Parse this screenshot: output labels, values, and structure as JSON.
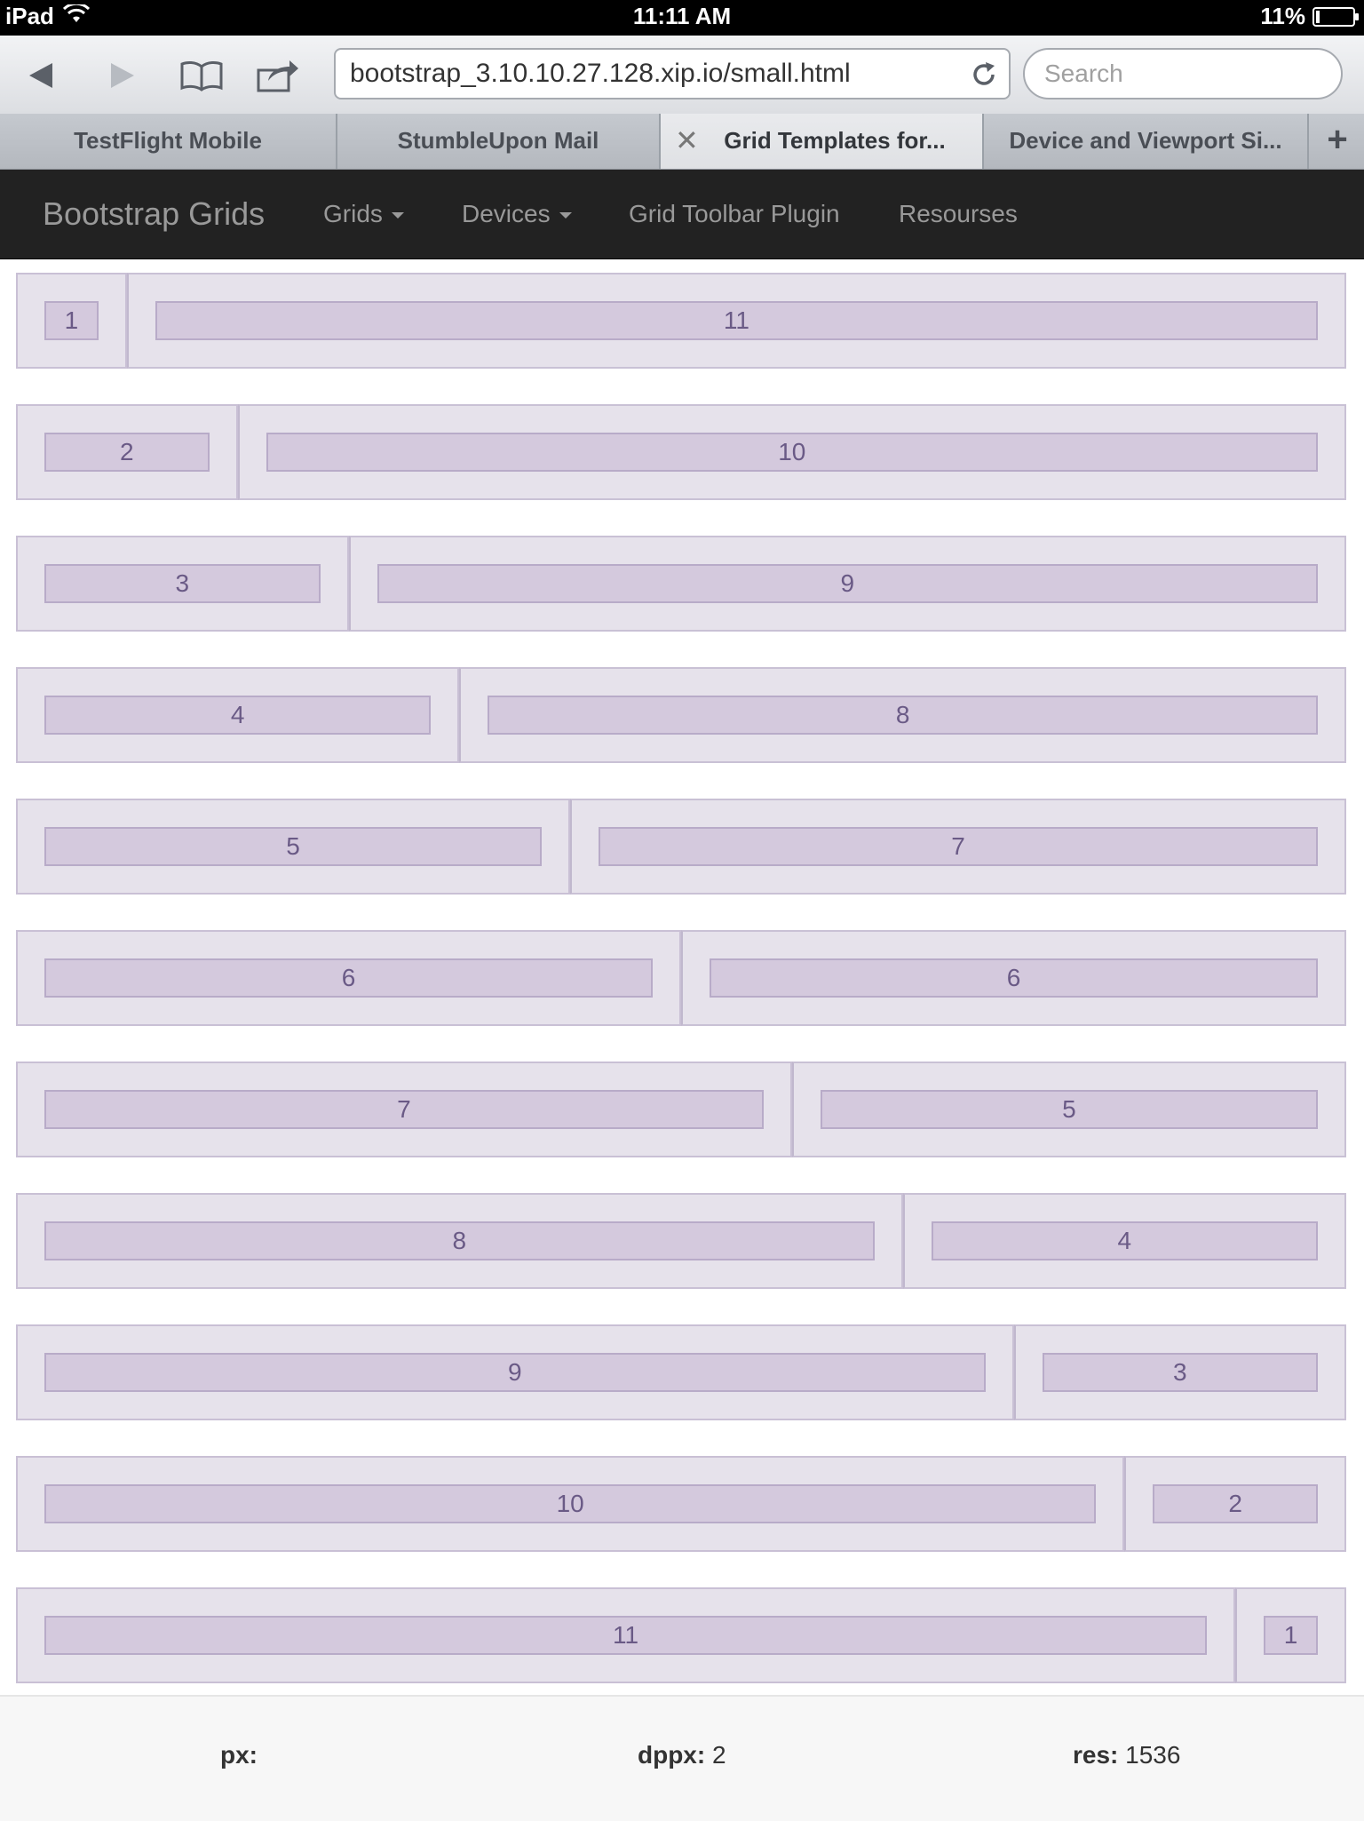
{
  "status_bar": {
    "device": "iPad",
    "time": "11:11 AM",
    "battery": "11%",
    "battery_level": 0.11
  },
  "browser": {
    "url": "bootstrap_3.10.10.27.128.xip.io/small.html",
    "search_placeholder": "Search",
    "tabs": [
      {
        "label": "TestFlight Mobile"
      },
      {
        "label": "StumbleUpon Mail"
      },
      {
        "label": "Grid Templates for..."
      },
      {
        "label": "Device and Viewport Si..."
      }
    ],
    "add_tab": "+"
  },
  "navbar": {
    "brand": "Bootstrap Grids",
    "items": [
      {
        "label": "Grids"
      },
      {
        "label": "Devices"
      },
      {
        "label": "Grid Toolbar Plugin"
      },
      {
        "label": "Resourses"
      }
    ]
  },
  "grid_rows": [
    [
      "1",
      "11"
    ],
    [
      "2",
      "10"
    ],
    [
      "3",
      "9"
    ],
    [
      "4",
      "8"
    ],
    [
      "5",
      "7"
    ],
    [
      "6",
      "6"
    ],
    [
      "7",
      "5"
    ],
    [
      "8",
      "4"
    ],
    [
      "9",
      "3"
    ],
    [
      "10",
      "2"
    ],
    [
      "11",
      "1"
    ]
  ],
  "footer": {
    "px_label": "px:",
    "px_value": "",
    "dppx_label": "dppx:",
    "dppx_value": "2",
    "res_label": "res:",
    "res_value": "1536"
  }
}
